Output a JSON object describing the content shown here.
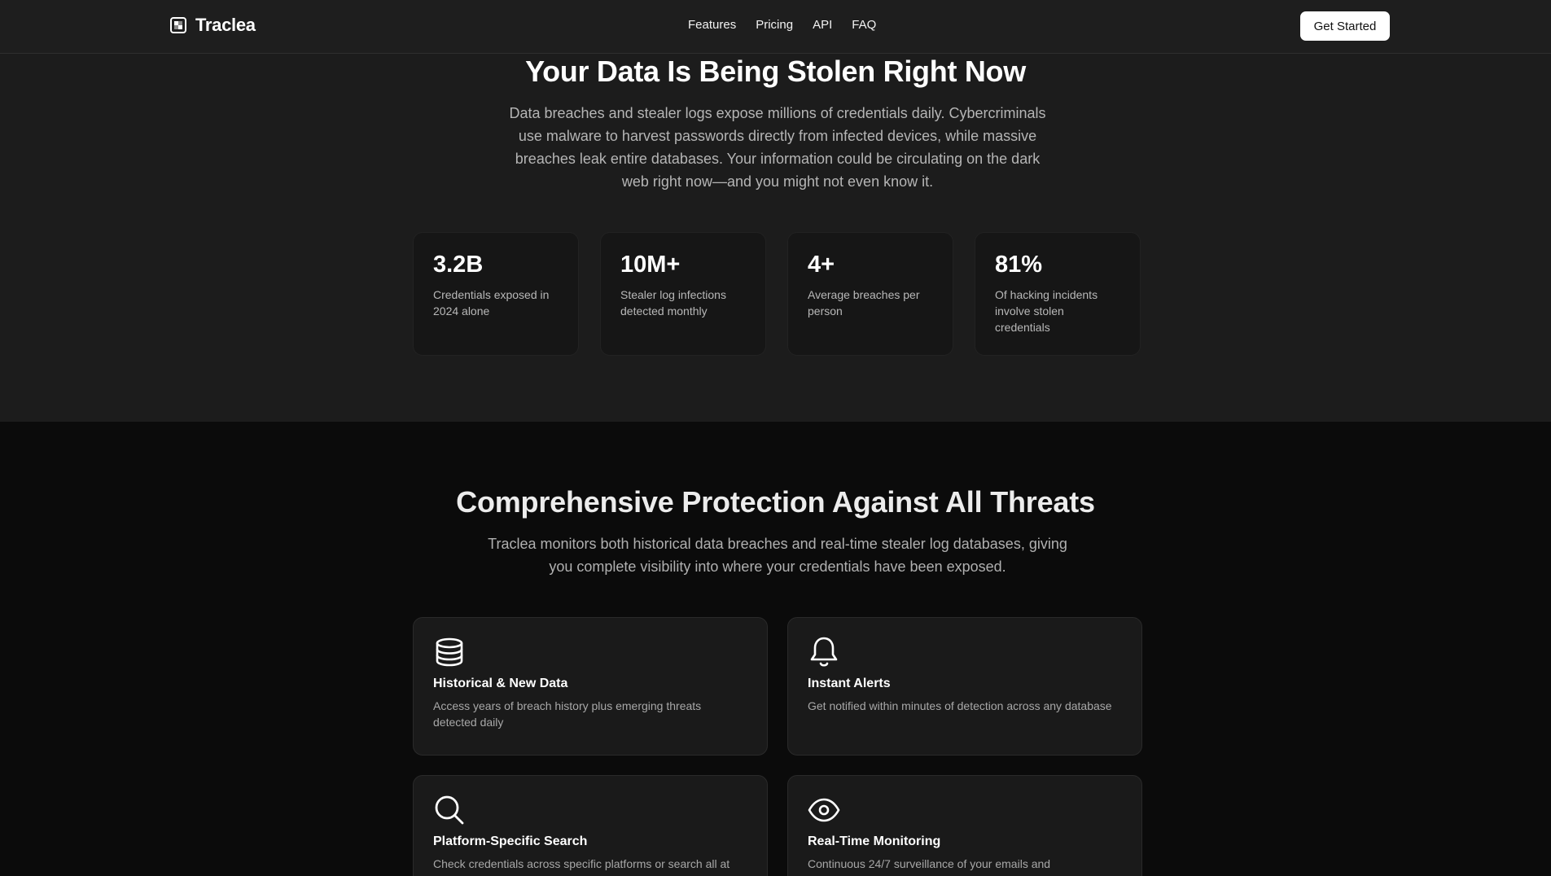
{
  "nav": {
    "brand": "Traclea",
    "links": [
      "Features",
      "Pricing",
      "API",
      "FAQ"
    ],
    "cta": "Get Started"
  },
  "hero": {
    "title": "Your Data Is Being Stolen Right Now",
    "description": "Data breaches and stealer logs expose millions of credentials daily. Cybercriminals use malware to harvest passwords directly from infected devices, while massive breaches leak entire databases. Your information could be circulating on the dark web right now—and you might not even know it.",
    "stats": [
      {
        "value": "3.2B",
        "label": "Credentials exposed in 2024 alone"
      },
      {
        "value": "10M+",
        "label": "Stealer log infections detected monthly"
      },
      {
        "value": "4+",
        "label": "Average breaches per person"
      },
      {
        "value": "81%",
        "label": "Of hacking incidents involve stolen credentials"
      }
    ]
  },
  "features": {
    "title": "Comprehensive Protection Against All Threats",
    "description": "Traclea monitors both historical data breaches and real-time stealer log databases, giving you complete visibility into where your credentials have been exposed.",
    "cards": [
      {
        "icon": "database-icon",
        "title": "Historical & New Data",
        "description": "Access years of breach history plus emerging threats detected daily"
      },
      {
        "icon": "bell-icon",
        "title": "Instant Alerts",
        "description": "Get notified within minutes of detection across any database"
      },
      {
        "icon": "search-icon",
        "title": "Platform-Specific Search",
        "description": "Check credentials across specific platforms or search all at"
      },
      {
        "icon": "eye-icon",
        "title": "Real-Time Monitoring",
        "description": "Continuous 24/7 surveillance of your emails and"
      }
    ]
  }
}
